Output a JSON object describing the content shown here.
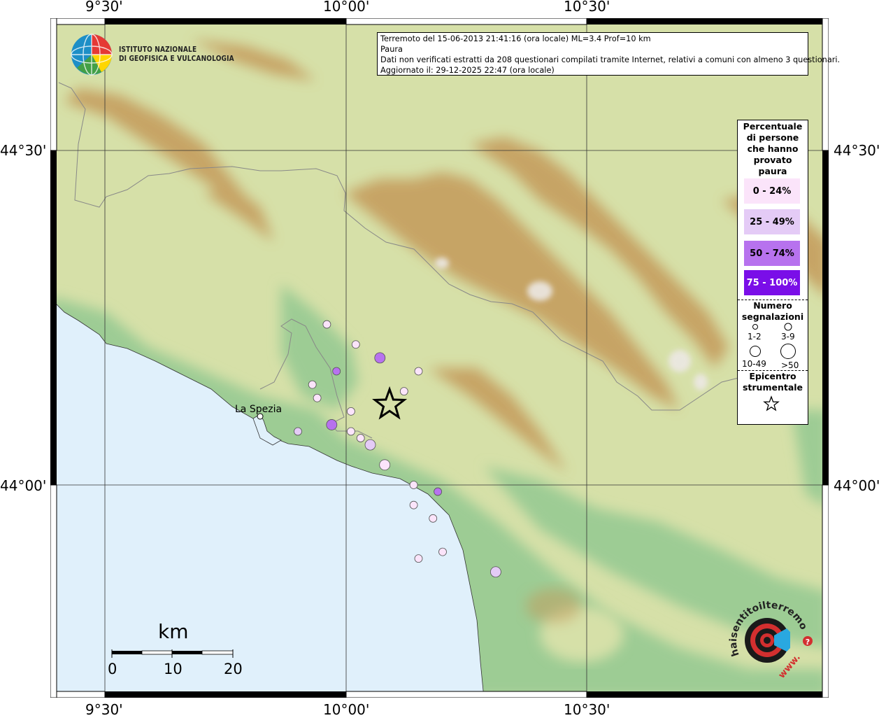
{
  "map": {
    "lon_labels": [
      "9°30'",
      "10°00'",
      "10°30'"
    ],
    "lat_labels": [
      "44°30'",
      "44°00'"
    ],
    "city": "La Spezia",
    "colors": {
      "sea": "#e0f0fb",
      "lowland": "#9dcc94",
      "hills": "#d6e0a8",
      "mountains": "#c49a5a",
      "peaks": "#ece8e4",
      "border": "#888888"
    }
  },
  "info": {
    "line1": "Terremoto del 15-06-2013 21:41:16 (ora locale) ML=3.4 Prof=10 km",
    "line2": "Paura",
    "line3": "Dati non verificati estratti da 208 questionari compilati tramite Internet, relativi a comuni con almeno 3 questionari.",
    "line4": "Aggiornato il: 29-12-2025 22:47 (ora locale)"
  },
  "logo": {
    "line1": "ISTITUTO NAZIONALE",
    "line2": "DI GEOFISICA E VULCANOLOGIA",
    "hst_text": "haisentitoilterremoto.it",
    "hst_www": "www.",
    "hst_q": "?"
  },
  "legend": {
    "title": "Percentuale di persone che hanno provato paura",
    "classes": [
      {
        "label": "0 - 24%",
        "color": "#fbe4fa",
        "text_color": "#000000"
      },
      {
        "label": "25 - 49%",
        "color": "#e4cbf6",
        "text_color": "#000000"
      },
      {
        "label": "50 - 74%",
        "color": "#b772ee",
        "text_color": "#000000"
      },
      {
        "label": "75 - 100%",
        "color": "#7a0ee8",
        "text_color": "#ffffff"
      }
    ],
    "count_title": "Numero segnalazioni",
    "count_classes": [
      "1-2",
      "3-9",
      "10-49",
      ">50"
    ],
    "epicenter_title": "Epicentro strumentale"
  },
  "scale": {
    "unit": "km",
    "ticks": [
      "0",
      "10",
      "20"
    ]
  },
  "points": [
    {
      "lon": 9.96,
      "lat": 44.24,
      "class": 0,
      "size": 1
    },
    {
      "lon": 10.02,
      "lat": 44.21,
      "class": 0,
      "size": 1
    },
    {
      "lon": 10.07,
      "lat": 44.19,
      "class": 2,
      "size": 2
    },
    {
      "lon": 9.98,
      "lat": 44.17,
      "class": 2,
      "size": 1
    },
    {
      "lon": 10.15,
      "lat": 44.17,
      "class": 0,
      "size": 1
    },
    {
      "lon": 9.93,
      "lat": 44.15,
      "class": 0,
      "size": 1
    },
    {
      "lon": 10.12,
      "lat": 44.14,
      "class": 0,
      "size": 1
    },
    {
      "lon": 9.94,
      "lat": 44.13,
      "class": 0,
      "size": 1
    },
    {
      "lon": 10.01,
      "lat": 44.11,
      "class": 0,
      "size": 1
    },
    {
      "lon": 9.97,
      "lat": 44.09,
      "class": 2,
      "size": 2
    },
    {
      "lon": 9.9,
      "lat": 44.08,
      "class": 1,
      "size": 1
    },
    {
      "lon": 10.01,
      "lat": 44.08,
      "class": 0,
      "size": 1
    },
    {
      "lon": 10.03,
      "lat": 44.07,
      "class": 0,
      "size": 1
    },
    {
      "lon": 10.05,
      "lat": 44.06,
      "class": 1,
      "size": 2
    },
    {
      "lon": 10.08,
      "lat": 44.03,
      "class": 0,
      "size": 2
    },
    {
      "lon": 10.14,
      "lat": 44.0,
      "class": 0,
      "size": 1
    },
    {
      "lon": 10.19,
      "lat": 43.99,
      "class": 2,
      "size": 1
    },
    {
      "lon": 10.14,
      "lat": 43.97,
      "class": 0,
      "size": 1
    },
    {
      "lon": 10.18,
      "lat": 43.95,
      "class": 0,
      "size": 1
    },
    {
      "lon": 10.2,
      "lat": 43.9,
      "class": 0,
      "size": 1
    },
    {
      "lon": 10.15,
      "lat": 43.89,
      "class": 0,
      "size": 1
    },
    {
      "lon": 10.31,
      "lat": 43.87,
      "class": 1,
      "size": 2
    }
  ],
  "epicenter": {
    "lon": 10.09,
    "lat": 44.12
  }
}
